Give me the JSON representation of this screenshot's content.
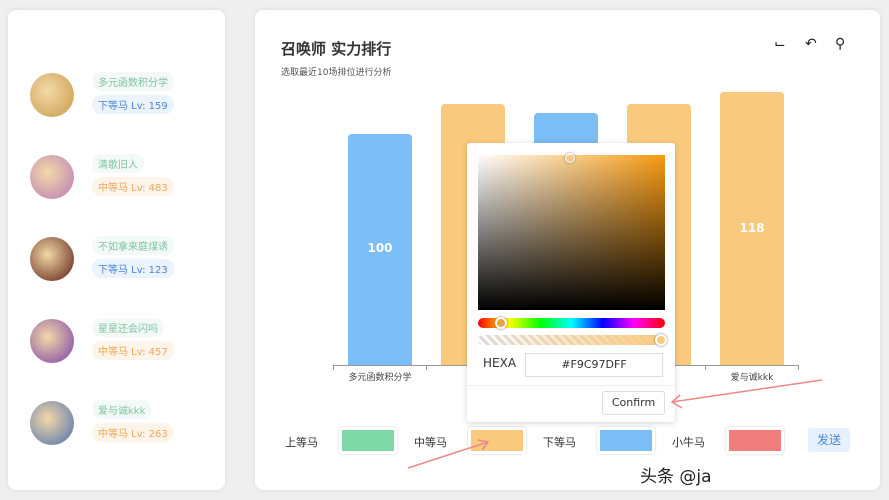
{
  "players": [
    {
      "name": "多元函数积分学",
      "rank": "下等马 Lv: 159",
      "tier": "low",
      "avatar_color": "#c99a4a"
    },
    {
      "name": "清歌旧人",
      "rank": "中等马 Lv: 483",
      "tier": "mid",
      "avatar_color": "#b87ab8"
    },
    {
      "name": "不如拿来庭煤诱",
      "rank": "下等马 Lv: 123",
      "tier": "low",
      "avatar_color": "#5a1a10"
    },
    {
      "name": "星星还会闪吗",
      "rank": "中等马 Lv: 457",
      "tier": "mid",
      "avatar_color": "#7a3fa8"
    },
    {
      "name": "爱与诚kkk",
      "rank": "中等马 Lv: 263",
      "tier": "mid",
      "avatar_color": "#4a6fb0"
    }
  ],
  "header": {
    "title": "召唤师 实力排行",
    "subtitle": "选取最近10场排位进行分析",
    "icons": [
      "crop-icon",
      "undo-icon",
      "hanger-icon"
    ]
  },
  "chart_data": {
    "type": "bar",
    "categories": [
      "多元函数积分学",
      "清歌旧人",
      "不如拿来庭煤诱",
      "星星还会闪吗",
      "爱与诚kkk"
    ],
    "visible_labels": [
      "多元函数积分学",
      "",
      "",
      "",
      "爱与诚kkk"
    ],
    "values": [
      100,
      113,
      109,
      113,
      118
    ],
    "shown_values": [
      "100",
      "",
      "",
      "",
      "118"
    ],
    "colors": [
      "#7bbdf5",
      "#f9c97d",
      "#7bbdf5",
      "#f9c97d",
      "#f9c97d"
    ],
    "ylim": [
      0,
      118
    ]
  },
  "legend": [
    {
      "label": "上等马",
      "color": "#7fd8a8"
    },
    {
      "label": "中等马",
      "color": "#f9c97d"
    },
    {
      "label": "下等马",
      "color": "#7bbdf5"
    },
    {
      "label": "小牛马",
      "color": "#f27d7d"
    }
  ],
  "send_label": "发送",
  "picker": {
    "mode_label": "HEXA",
    "hex_value": "#F9C97DFF",
    "confirm_label": "Confirm"
  },
  "watermark": "头条 @ja"
}
